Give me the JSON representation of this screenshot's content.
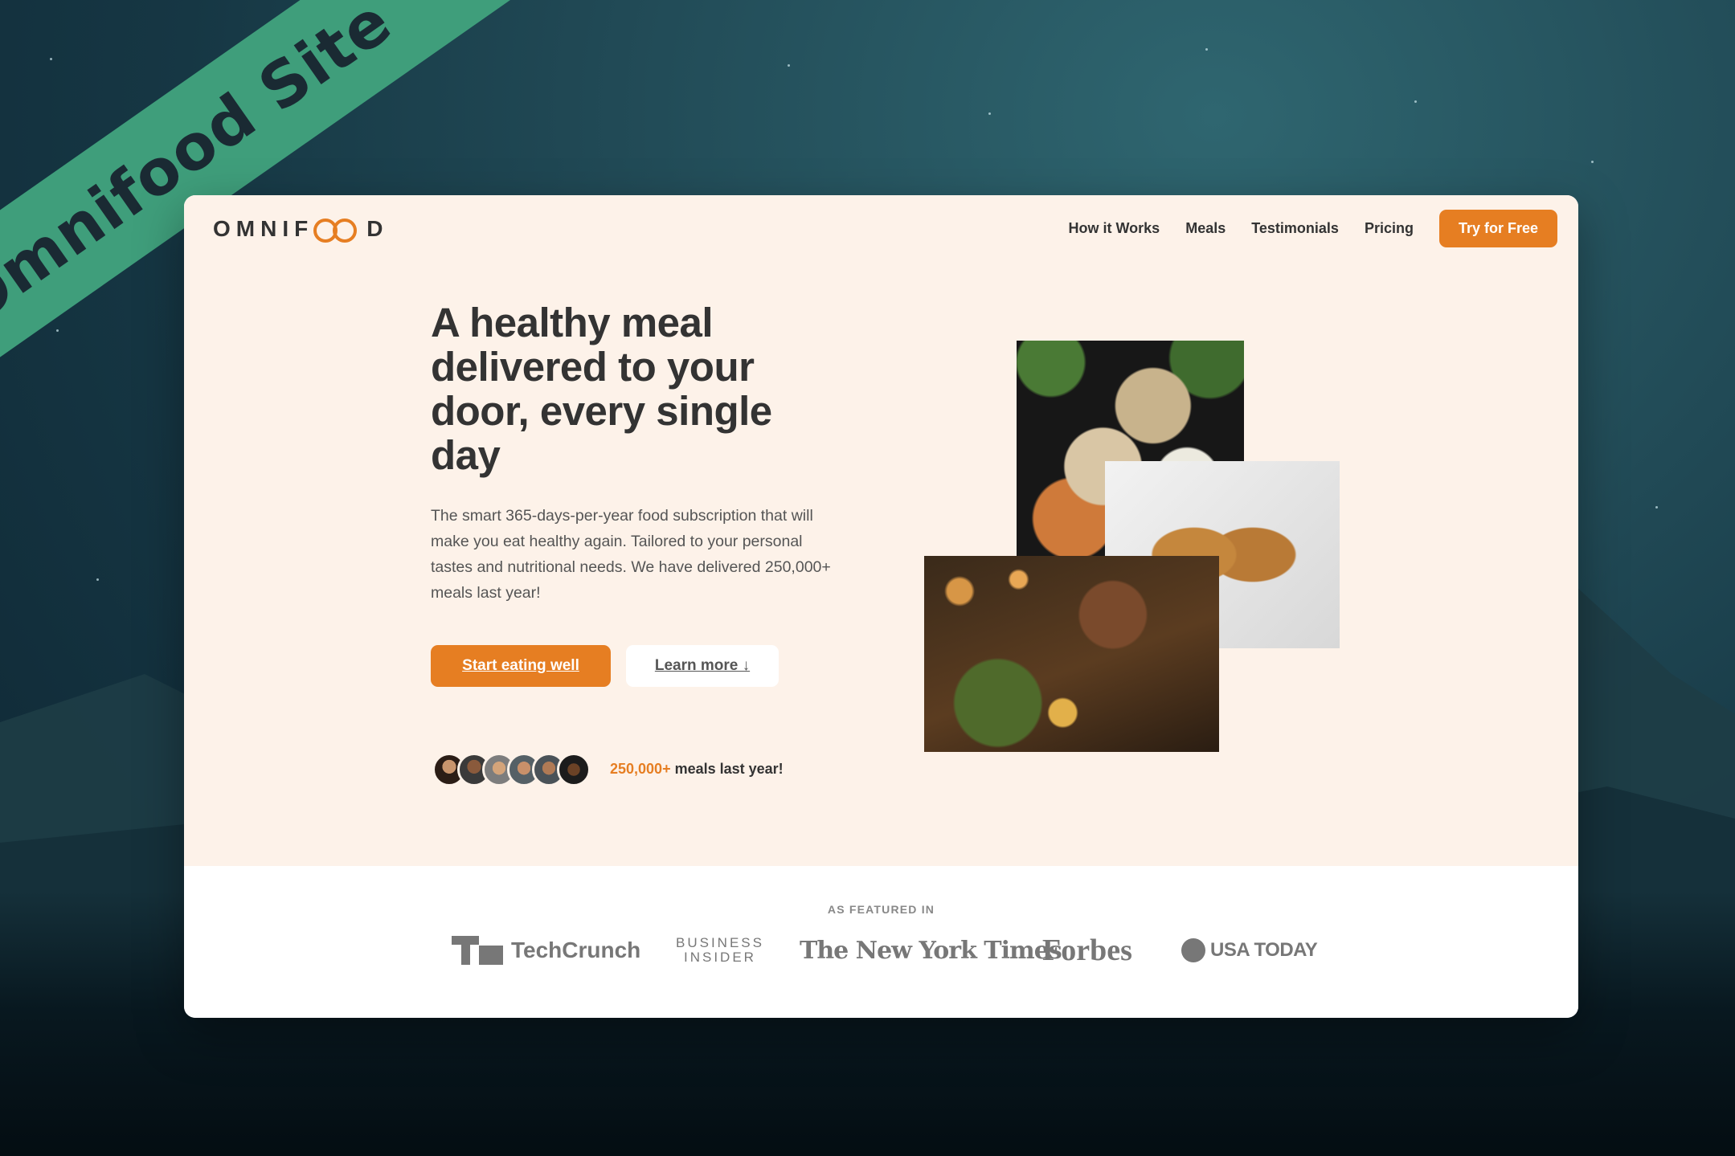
{
  "banner": {
    "label": "Omnifood Site"
  },
  "brand": {
    "logo_text_left": "OMNIF",
    "logo_text_right": "D"
  },
  "nav": {
    "items": [
      "How it Works",
      "Meals",
      "Testimonials",
      "Pricing"
    ],
    "cta_label": "Try for Free"
  },
  "hero": {
    "headline": "A healthy meal delivered to your door, every single day",
    "description": "The smart 365-days-per-year food subscription that will make you eat healthy again. Tailored to your personal tastes and nutritional needs. We have delivered 250,000+ meals last year!",
    "primary_button": "Start eating well",
    "secondary_button": "Learn more ↓",
    "delivered_number": "250,000+",
    "delivered_text": " meals last year!",
    "avatar_count": 6
  },
  "featured": {
    "title": "AS FEATURED IN",
    "logos": [
      "TechCrunch",
      "BUSINESS\nINSIDER",
      "The New York Times",
      "Forbes",
      "USA TODAY"
    ]
  },
  "colors": {
    "accent": "#e67e22",
    "hero_bg": "#fdf2e9",
    "banner": "#3f9e7b"
  }
}
